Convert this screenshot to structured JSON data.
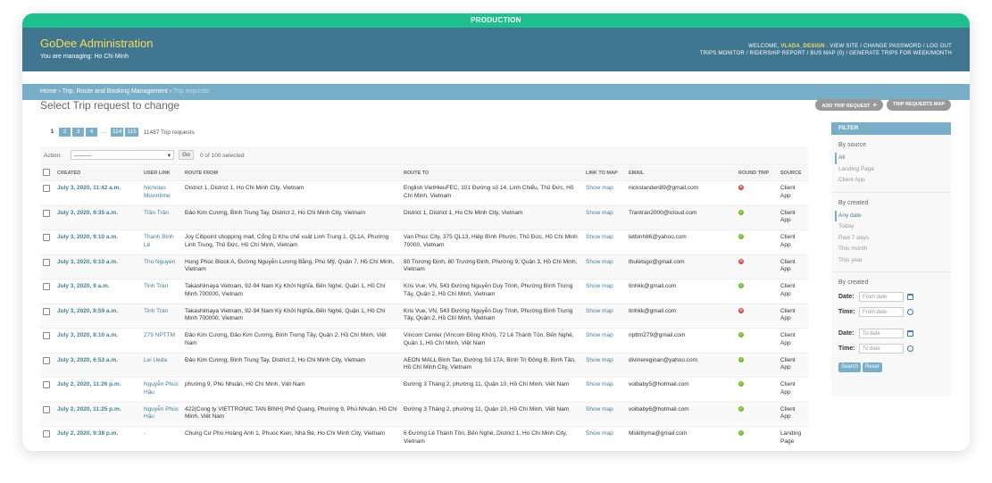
{
  "env_banner": "PRODUCTION",
  "header": {
    "brand": "GoDee Administration",
    "managing": "You are managing: Ho Chi Minh",
    "welcome": "WELCOME,",
    "username": "VLADA_DESIGN",
    "links_line1": ". VIEW SITE / CHANGE PASSWORD / LOG OUT",
    "links_line2": "TRIPS MONITOR / RIDERSHIP REPORT / BUS MAP (0) / GENERATE TRIPS FOR WEEK/MONTH"
  },
  "breadcrumb": {
    "home": "Home",
    "sep1": " › ",
    "section": "Trip, Route and Booking Management",
    "sep2": " › ",
    "current": "Trip requests"
  },
  "page_title": "Select Trip request to change",
  "object_tools": {
    "add_label": "ADD TRIP REQUEST",
    "add_icon": "+",
    "map_label": "TRIP REQUESTS MAP"
  },
  "paginator": {
    "current": "1",
    "pages": [
      "2",
      "3",
      "4"
    ],
    "dots": "...",
    "last_pages": [
      "114",
      "115"
    ],
    "count": "11487 Trip requests"
  },
  "actions": {
    "label": "Action:",
    "select_value": "---------",
    "go": "Go",
    "selected": "0 of 100 selected"
  },
  "table": {
    "headers": {
      "created": "CREATED",
      "user_link": "USER LINK",
      "route_from": "ROUTE FROM",
      "route_to": "ROUTE TO",
      "link_to_map": "LINK TO MAP",
      "email": "EMAIL",
      "round_trip": "ROUND TRIP",
      "source": "SOURCE"
    },
    "rows": [
      {
        "created": "July 3, 2020, 11:42 a.m.",
        "user": "Nicholas Movintime",
        "from": "District 1, District 1, Ho Chi Minh City, Vietnam",
        "to": "English VietHieuFEC, 101 Đường số 14, Linh Chiểu, Thủ Đức, Hồ Chí Minh, Vietnam",
        "map": "Show map",
        "email": "nickstanden89@gmail.com",
        "round": "no",
        "source": "Client App"
      },
      {
        "created": "July 3, 2020, 9:35 a.m.",
        "user": "Trần Trân",
        "from": "Đảo Kim Cương, Bình Trung Tay, District 2, Ho Chi Minh City, Vietnam",
        "to": "District 1, District 1, Ho Chi Minh City, Vietnam",
        "map": "Show map",
        "email": "Trantran2000@icloud.com",
        "round": "yes",
        "source": "Client App"
      },
      {
        "created": "July 3, 2020, 9:10 a.m.",
        "user": "Thanh Bình Lê",
        "from": "Joy Citipoint shopping mall, Cổng D Khu chế xuất Linh Trung 1, QL1A, Phường Linh Trung, Thủ Đức, Hồ Chí Minh, Vietnam",
        "to": "Van Phúc City, 375 QL13, Hiệp Bình Phước, Thủ Đức, Hồ Chí Minh 70000, Vietnam",
        "map": "Show map",
        "email": "letbinh86@yahoo.com",
        "round": "yes",
        "source": "Client App"
      },
      {
        "created": "July 3, 2020, 9:10 a.m.",
        "user": "Thu Nguyen",
        "from": "Hung Phúc Block A, Đường Nguyễn Lương Bằng, Phú Mỹ, Quận 7, Hồ Chí Minh, Vietnam",
        "to": "80 Trương Định, 80 Trương Định, Phường 9, Quận 3, Hồ Chí Minh, Vietnam",
        "map": "Show map",
        "email": "thuletsgo@gmail.com",
        "round": "no",
        "source": "Client App"
      },
      {
        "created": "July 3, 2020, 9 a.m.",
        "user": "Tinh Tran",
        "from": "Takashimaya Vietnam, 92-94 Nam Kỳ Khởi Nghĩa, Bến Nghé, Quận 1, Hồ Chí Minh 700000, Vietnam",
        "to": "Kris Vue, VN, 543 Đường Nguyễn Duy Trinh, Phường Bình Trưng Tây, Quận 2, Hồ Chí Minh, Vietnam",
        "map": "Show map",
        "email": "tinhkk@gmail.com",
        "round": "yes",
        "source": "Client App"
      },
      {
        "created": "July 3, 2020, 8:59 a.m.",
        "user": "Tinh Tran",
        "from": "Takashimaya Vietnam, 92-94 Nam Kỳ Khởi Nghĩa, Bến Nghé, Quận 1, Hồ Chí Minh 700000, Vietnam",
        "to": "Kris Vue, VN, 543 Đường Nguyễn Duy Trinh, Phường Bình Trưng Tây, Quận 2, Hồ Chí Minh, Vietnam",
        "map": "Show map",
        "email": "tinhkk@gmail.com",
        "round": "no",
        "source": "Client App"
      },
      {
        "created": "July 3, 2020, 8:10 a.m.",
        "user": "279 NPTTM",
        "from": "Đảo Kim Cương, Đảo Kim Cương, Bình Trưng Tây, Quận 2, Hồ Chí Minh, Việt Nam",
        "to": "Vincom Center (Vincom Đồng Khởi), 72 Lê Thánh Tôn, Bến Nghé, Quận 1, Hồ Chí Minh, Việt Nam",
        "map": "Show map",
        "email": "npttm279@gmail.com",
        "round": "yes",
        "source": "Client App"
      },
      {
        "created": "July 3, 2020, 6:53 a.m.",
        "user": "Lei Ueda",
        "from": "Đảo Kim Cương, Bình Trung Tay, District 2, Ho Chi Minh City, Vietnam",
        "to": "AEON MALL Bình Tan, Đường Số 17A, Bình Trị Đông B, Bình Tân, Hồ Chí Minh City, Vietnam",
        "map": "Show map",
        "email": "divinereginan@yahoo.com",
        "round": "yes",
        "source": "Client App"
      },
      {
        "created": "July 2, 2020, 11:26 p.m.",
        "user": "Nguyễn Phúc Hậu",
        "from": "phường 9, Phú Nhuận, Hồ Chí Minh, Việt Nam",
        "to": "Đường 3 Tháng 2, phường 11, Quận 10, Hồ Chí Minh, Việt Nam",
        "map": "Show map",
        "email": "voibaby5@hotmail.com",
        "round": "yes",
        "source": "Client App"
      },
      {
        "created": "July 2, 2020, 11:25 p.m.",
        "user": "Nguyễn Phúc Hậu",
        "from": "422(Cong ty VIETTRONIC TAN BINH) Phổ Quang, Phường 9, Phú Nhuận, Hồ Chí Minh, Việt Nam",
        "to": "Đường 3 Tháng 2, phường 11, Quận 10, Hồ Chí Minh, Việt Nam",
        "map": "Show map",
        "email": "voibaby6@hotmail.com",
        "round": "yes",
        "source": "Client App"
      },
      {
        "created": "July 2, 2020, 9:38 p.m.",
        "user": "-",
        "from": "Chung Cư Phú Hoàng Anh 1, Phuoc Kien, Nhà Bè, Ho Chi Minh City, Vietnam",
        "to": "6 Đường Lê Thánh Tôn, Bến Nghé, District 1, Ho Chi Minh City, Vietnam",
        "map": "Show map",
        "email": "Mskittyma@gmail.com",
        "round": "yes",
        "source": "Landing Page"
      }
    ]
  },
  "filter": {
    "title": "FILTER",
    "by_source": "By source",
    "source_options": [
      "All",
      "Landing Page",
      "Client App"
    ],
    "by_created": "By created",
    "created_options": [
      "Any date",
      "Today",
      "Past 7 days",
      "This month",
      "This year"
    ],
    "by_created2": "By created",
    "date_label": "Date:",
    "time_label": "Time:",
    "from_date_ph": "From date",
    "from_time_ph": "From date",
    "to_date_ph": "To date",
    "to_time_ph": "To date",
    "search": "Search",
    "reset": "Reset"
  },
  "colors": {
    "header_bg": "#417690",
    "brand": "#f5dd5d",
    "breadcrumb_bg": "#79aec8",
    "env_bg": "#1fbf8f",
    "link": "#447e9b",
    "yes": "#70bf2b",
    "no": "#dd4646"
  }
}
